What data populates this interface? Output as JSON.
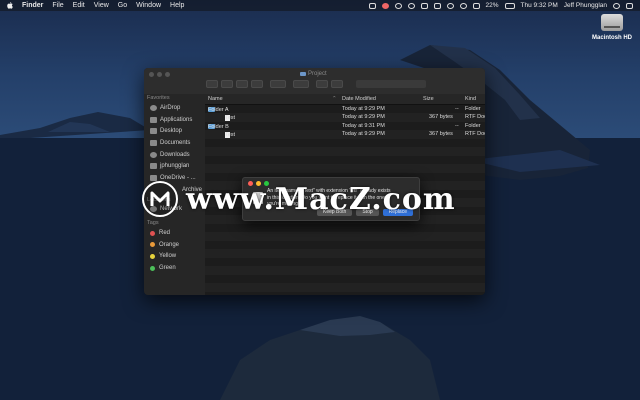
{
  "menubar": {
    "app": "Finder",
    "items": [
      "File",
      "Edit",
      "View",
      "Go",
      "Window",
      "Help"
    ],
    "battery": "22%",
    "clock": "Thu 9:32 PM",
    "user": "Jeff Phungglan"
  },
  "desktop": {
    "disk_label": "Macintosh HD"
  },
  "finder": {
    "title": "Project",
    "sidebar": {
      "favorites_header": "Favorites",
      "items": [
        "AirDrop",
        "Applications",
        "Desktop",
        "Documents",
        "Downloads",
        "jphungglan",
        "OneDrive - ..."
      ],
      "partial_item": "Archive",
      "locations_header": "Locations",
      "locations": [
        "Network"
      ],
      "tags_header": "Tags",
      "tags": [
        {
          "label": "Red",
          "color": "#e05252"
        },
        {
          "label": "Orange",
          "color": "#e99a3a"
        },
        {
          "label": "Yellow",
          "color": "#e6d23c"
        },
        {
          "label": "Green",
          "color": "#4cbf5a"
        }
      ]
    },
    "columns": {
      "name": "Name",
      "date": "Date Modified",
      "size": "Size",
      "kind": "Kind"
    },
    "rows": [
      {
        "name": "Folder A",
        "date": "Today at 9:29 PM",
        "size": "--",
        "kind": "Folder"
      },
      {
        "name": "Test",
        "date": "Today at 9:29 PM",
        "size": "367 bytes",
        "kind": "RTF Doc"
      },
      {
        "name": "Folder B",
        "date": "Today at 9:31 PM",
        "size": "--",
        "kind": "Folder"
      },
      {
        "name": "Test",
        "date": "Today at 9:29 PM",
        "size": "367 bytes",
        "kind": "RTF Doc"
      }
    ]
  },
  "dialog": {
    "line1": "An item named \"Test\" with extension \".rtf\" already exists",
    "line2": "in this location. Do you want to replace it with the one",
    "line3": "you're moving?",
    "buttons": [
      "Keep Both",
      "Stop",
      "Replace"
    ]
  },
  "watermark": {
    "text": "www.MacZ.com"
  }
}
